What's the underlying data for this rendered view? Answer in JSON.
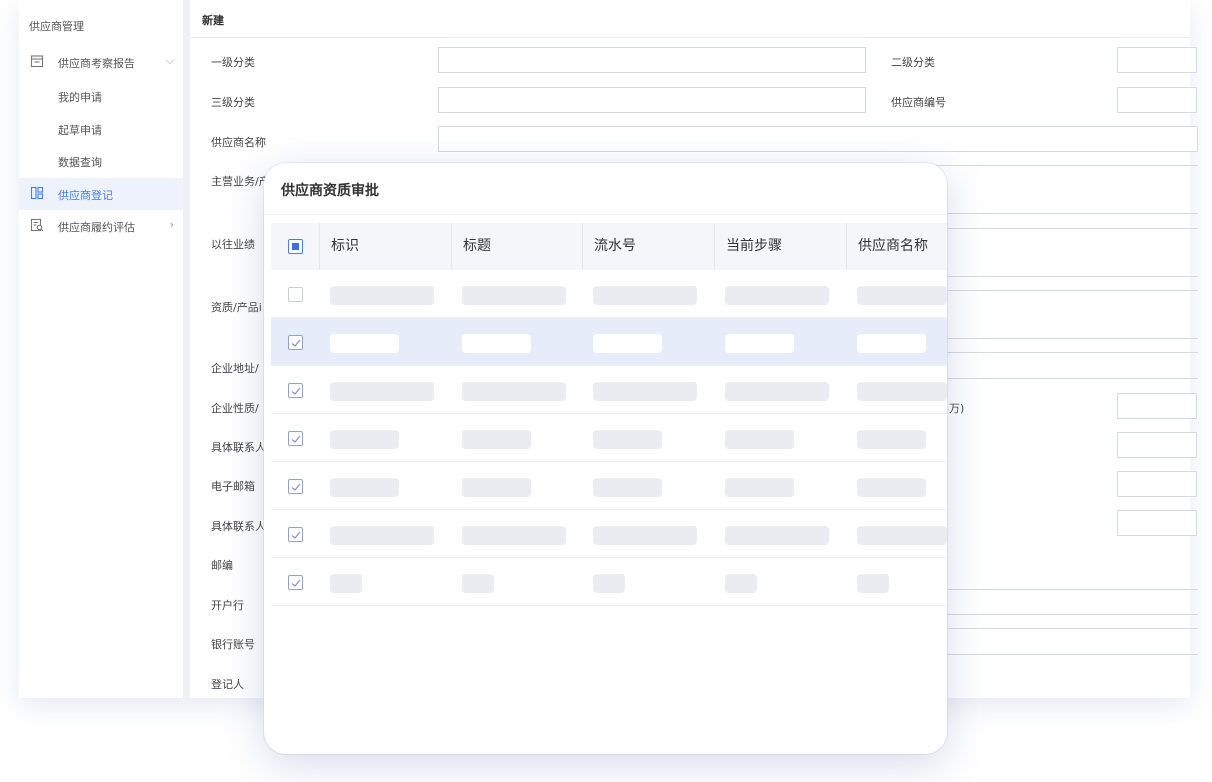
{
  "sidebar": {
    "title": "供应商管理",
    "items": [
      {
        "label": "供应商考察报告",
        "icon": "calendar-icon",
        "arrow": "⌵"
      },
      {
        "label": "我的申请"
      },
      {
        "label": "起草申请"
      },
      {
        "label": "数据查询"
      },
      {
        "label": "供应商登记",
        "icon": "layout-icon",
        "active": true
      },
      {
        "label": "供应商履约评估",
        "icon": "document-search-icon",
        "arrow": "›"
      }
    ]
  },
  "form": {
    "header": "新建",
    "labels": {
      "cat1": "一级分类",
      "cat2": "二级分类",
      "cat3": "三级分类",
      "supplier_no": "供应商编号",
      "supplier_name": "供应商名称",
      "main_business": "主营业务/产",
      "past_performance": "以往业绩",
      "qualification": "资质/产品i",
      "address": "企业地址/",
      "nature": "企业性质/",
      "contact1": "具体联系人",
      "email": "电子邮箱",
      "contact2": "具体联系人",
      "postcode": "邮编",
      "bank": "开户行",
      "bank_account": "银行账号",
      "registrant": "登记人",
      "capital_suffix": "万)"
    }
  },
  "modal": {
    "title": "供应商资质审批",
    "columns": [
      "标识",
      "标题",
      "流水号",
      "当前步骤",
      "供应商名称"
    ],
    "rows": [
      {
        "checked": false,
        "selected": false
      },
      {
        "checked": true,
        "selected": true
      },
      {
        "checked": true,
        "selected": false
      },
      {
        "checked": true,
        "selected": false
      },
      {
        "checked": true,
        "selected": false
      },
      {
        "checked": true,
        "selected": false
      },
      {
        "checked": true,
        "selected": false
      }
    ]
  },
  "colors": {
    "accent": "#4a7cf0",
    "selected_row": "#e6ecf9",
    "placeholder": "#eaecf1",
    "header_bg": "#f4f6fa"
  }
}
